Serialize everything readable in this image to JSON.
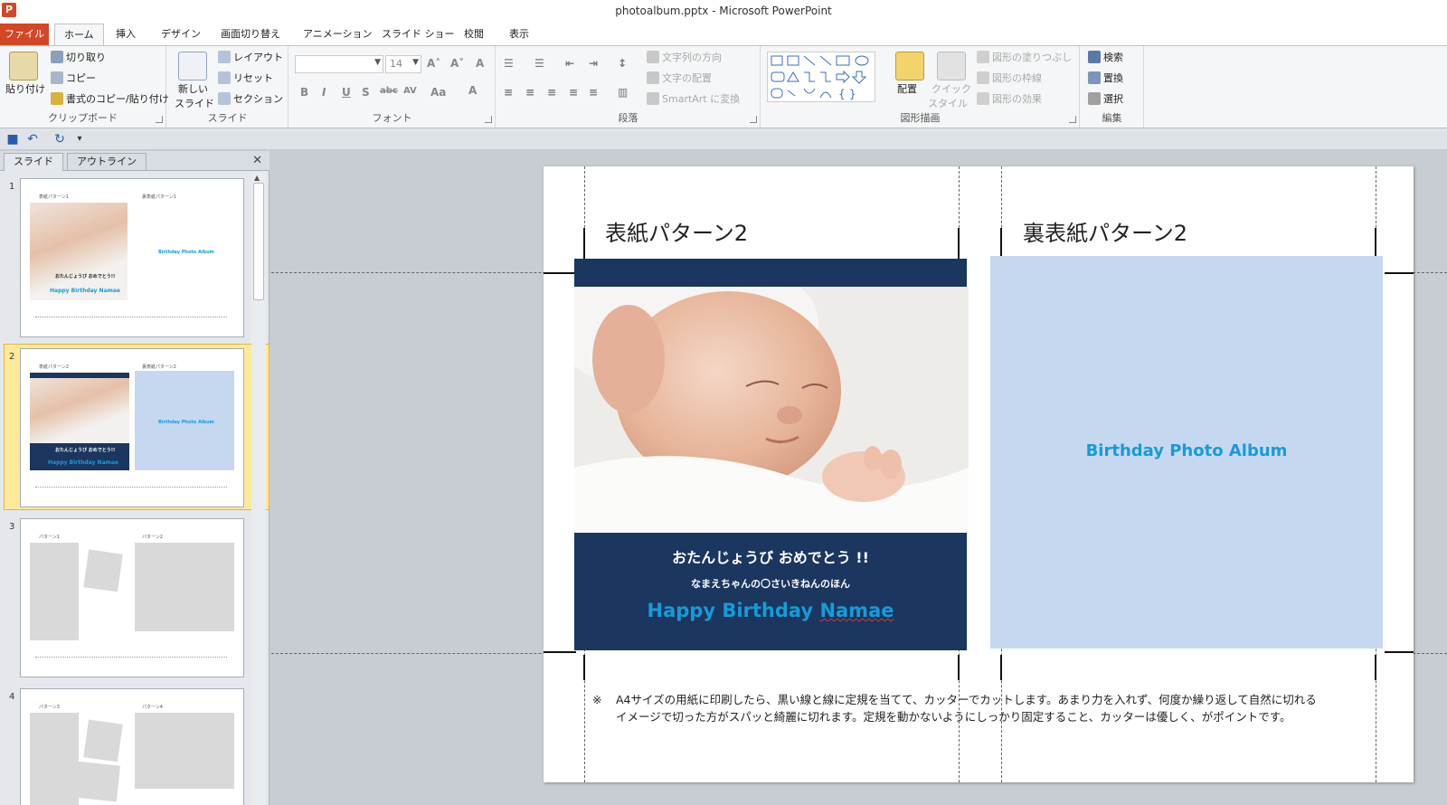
{
  "window": {
    "title": "photoalbum.pptx - Microsoft PowerPoint",
    "app_icon": "P"
  },
  "tabs": [
    {
      "label": "ファイル"
    },
    {
      "label": "ホーム"
    },
    {
      "label": "挿入"
    },
    {
      "label": "デザイン"
    },
    {
      "label": "画面切り替え"
    },
    {
      "label": "アニメーション"
    },
    {
      "label": "スライド ショー"
    },
    {
      "label": "校閲"
    },
    {
      "label": "表示"
    }
  ],
  "ribbon": {
    "clipboard": {
      "paste": "貼り付け",
      "cut": "切り取り",
      "copy": "コピー",
      "format_painter": "書式のコピー/貼り付け",
      "label": "クリップボード"
    },
    "slides": {
      "new_slide": "新しい",
      "new_slide2": "スライド",
      "layout": "レイアウト",
      "reset": "リセット",
      "section": "セクション",
      "label": "スライド"
    },
    "font": {
      "size": "14",
      "label": "フォント"
    },
    "paragraph": {
      "text_direction": "文字列の方向",
      "align_text": "文字の配置",
      "smartart": "SmartArt に変換",
      "label": "段落"
    },
    "drawing": {
      "arrange": "配置",
      "quick_styles": "クイック",
      "quick_styles2": "スタイル",
      "shape_fill": "図形の塗りつぶし",
      "shape_outline": "図形の枠線",
      "shape_effects": "図形の効果",
      "label": "図形描画"
    },
    "editing": {
      "find": "検索",
      "replace": "置換",
      "select": "選択",
      "label": "編集"
    }
  },
  "left_pane": {
    "tabs": [
      "スライド",
      "アウトライン"
    ],
    "slides": [
      {
        "number": "1",
        "left_label": "表紙パターン1",
        "right_label": "裏表紙パターン1",
        "center_text": "Birthday Photo Album",
        "cover_line1": "おたんじょうび おめでとう!!",
        "cover_line3": "Happy Birthday Namae"
      },
      {
        "number": "2",
        "left_label": "表紙パターン2",
        "right_label": "裏表紙パターン2",
        "center_text": "Birthday Photo Album",
        "cover_line1": "おたんじょうび おめでとう!!",
        "cover_line3": "Happy Birthday Namae"
      },
      {
        "number": "3",
        "left_label": "パターン1",
        "right_label": "パターン2"
      },
      {
        "number": "4",
        "left_label": "パターン3",
        "right_label": "パターン4"
      }
    ]
  },
  "slide": {
    "front_heading": "表紙パターン2",
    "back_heading": "裏表紙パターン2",
    "cover_line1": "おたんじょうび おめでとう !!",
    "cover_line2": "なまえちゃんの〇さいきねんのほん",
    "cover_line3_a": "Happy Birthday ",
    "cover_line3_b": "Namae",
    "back_title": "Birthday Photo Album",
    "note_mark": "※",
    "note_line1": "A4サイズの用紙に印刷したら、黒い線と線に定規を当てて、カッターでカットします。あまり力を入れず、何度か繰り返して自然に切れる",
    "note_line2": "イメージで切った方がスパッと綺麗に切れます。定規を動かないようにしっかり固定すること、カッターは優しく、がポイントです。"
  },
  "colors": {
    "accent_file_tab": "#d24726",
    "navy": "#1b365f",
    "cover_blue": "#169bd8",
    "back_cover": "#c6d8f0"
  }
}
